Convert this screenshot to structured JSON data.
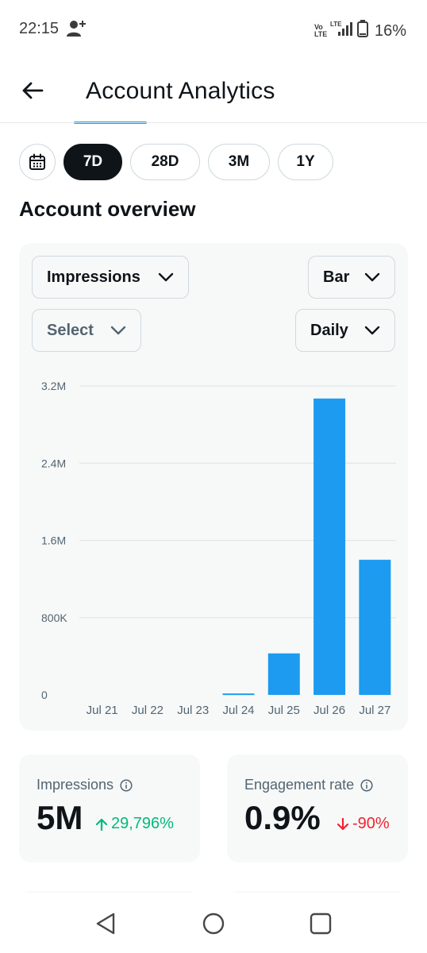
{
  "status_bar": {
    "time": "22:15",
    "battery": "16%",
    "volte_label": "Vo LTE",
    "network_label": "LTE"
  },
  "header": {
    "title": "Account Analytics"
  },
  "ranges": [
    {
      "label": "7D",
      "active": true
    },
    {
      "label": "28D",
      "active": false
    },
    {
      "label": "3M",
      "active": false
    },
    {
      "label": "1Y",
      "active": false
    }
  ],
  "section_title": "Account overview",
  "controls": {
    "metric": "Impressions",
    "chart_type": "Bar",
    "compare": "Select",
    "interval": "Daily"
  },
  "chart_data": {
    "type": "bar",
    "categories": [
      "Jul 21",
      "Jul 22",
      "Jul 23",
      "Jul 24",
      "Jul 25",
      "Jul 26",
      "Jul 27"
    ],
    "values": [
      0,
      0,
      0,
      15000,
      430000,
      3070000,
      1400000
    ],
    "y_ticks": [
      {
        "value": 0,
        "label": "0"
      },
      {
        "value": 800000,
        "label": "800K"
      },
      {
        "value": 1600000,
        "label": "1.6M"
      },
      {
        "value": 2400000,
        "label": "2.4M"
      },
      {
        "value": 3200000,
        "label": "3.2M"
      }
    ],
    "ylim": [
      0,
      3200000
    ],
    "grid": true,
    "bar_color": "#1d9bf0"
  },
  "stats": {
    "impressions": {
      "label": "Impressions",
      "value": "5M",
      "change": "29,796%",
      "direction": "up"
    },
    "engagement_rate": {
      "label": "Engagement rate",
      "value": "0.9%",
      "change": "-90%",
      "direction": "down"
    }
  },
  "colors": {
    "accent": "#1d9bf0",
    "positive": "#00ba7c",
    "negative": "#f4212e",
    "text": "#0f1419",
    "muted": "#536471"
  }
}
